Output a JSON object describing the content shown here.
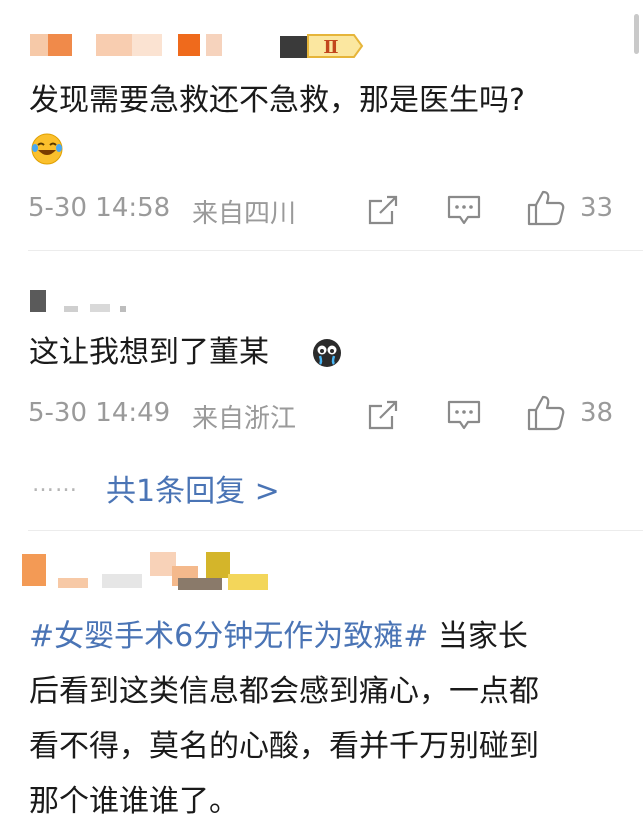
{
  "comments": [
    {
      "text": "发现需要急救还不急救，那是医生吗?",
      "emoji": "laughing-crying-emoji",
      "time": "5-30 14:58",
      "location": "来自四川",
      "likes": "33",
      "badge": "Ⅱ"
    },
    {
      "text": "这让我想到了董某",
      "emoji": "crying-face-emoji",
      "time": "5-30 14:49",
      "location": "来自浙江",
      "likes": "38",
      "replies_label": "共1条回复 >",
      "dots": "……"
    },
    {
      "topic": "#女婴手术6分钟无作为致瘫#",
      "text_line1": " 当家长",
      "text_line2": "后看到这类信息都会感到痛心，一点都",
      "text_line3": "看不得，莫名的心酸，看并千万别碰到",
      "text_line4": "那个谁谁谁了。"
    }
  ],
  "colors": {
    "link": "#4a74b5",
    "meta": "#9a9a9a",
    "text": "#1a1a1a"
  }
}
